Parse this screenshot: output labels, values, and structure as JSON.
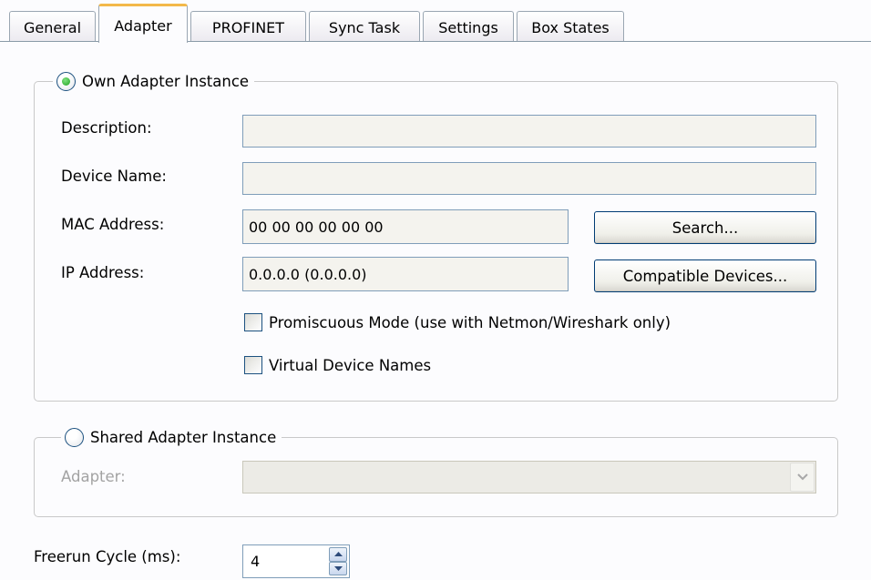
{
  "tabs": [
    {
      "label": "General",
      "active": false
    },
    {
      "label": "Adapter",
      "active": true
    },
    {
      "label": "PROFINET",
      "active": false
    },
    {
      "label": "Sync Task",
      "active": false
    },
    {
      "label": "Settings",
      "active": false
    },
    {
      "label": "Box States",
      "active": false
    }
  ],
  "own_adapter": {
    "legend": "Own Adapter Instance",
    "selected": true,
    "description_label": "Description:",
    "description_value": "",
    "device_name_label": "Device Name:",
    "device_name_value": "",
    "mac_label": "MAC Address:",
    "mac_value": "00 00 00 00 00 00",
    "search_button": "Search...",
    "ip_label": "IP Address:",
    "ip_value": "0.0.0.0 (0.0.0.0)",
    "compatible_button": "Compatible Devices...",
    "promiscuous_label": "Promiscuous Mode (use with Netmon/Wireshark only)",
    "promiscuous_checked": false,
    "virtual_names_label": "Virtual Device Names",
    "virtual_names_checked": false
  },
  "shared_adapter": {
    "legend": "Shared Adapter Instance",
    "selected": false,
    "adapter_label": "Adapter:",
    "adapter_value": ""
  },
  "freerun": {
    "label": "Freerun Cycle (ms):",
    "value": "4"
  },
  "colors": {
    "active_tab_accent": "#f3b94a",
    "radio_selected": "#21a121",
    "field_border": "#7f9db9",
    "button_border": "#003c74"
  }
}
